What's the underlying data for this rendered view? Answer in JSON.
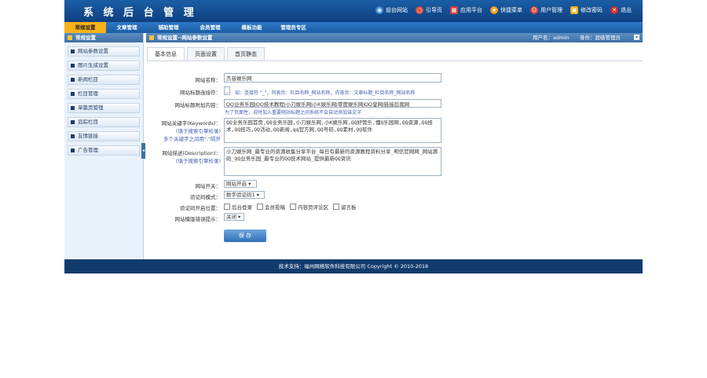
{
  "app": {
    "title": "系 统 后 台 管 理"
  },
  "top_links": [
    {
      "label": "前台网站",
      "icon": "globe-icon",
      "color": "#3b8de0"
    },
    {
      "label": "引导页",
      "icon": "lifebuoy-icon",
      "color": "#e04b3b"
    },
    {
      "label": "应用平台",
      "icon": "grid-icon",
      "color": "#d04040"
    },
    {
      "label": "快捷菜单",
      "icon": "star-icon",
      "color": "#f0a020"
    },
    {
      "label": "用户管理",
      "icon": "user-icon",
      "color": "#e04040"
    },
    {
      "label": "修改密码",
      "icon": "lock-icon",
      "color": "#f0b020"
    },
    {
      "label": "退出",
      "icon": "close-icon",
      "color": "#d03030"
    }
  ],
  "main_menu": [
    "常规设置",
    "文章管理",
    "辅助管理",
    "会员管理",
    "模板功能",
    "管理员专区"
  ],
  "sidebar": {
    "title": "常规设置",
    "items": [
      "网站参数设置",
      "图片生成设置",
      "新闻栏目",
      "栏目管理",
      "单篇页管理",
      "追踪栏目",
      "友情链接",
      "广告管理"
    ]
  },
  "pathbar": {
    "path": "常规设置--网站参数设置",
    "user": "用户名：admin",
    "auth": "身份：超级管理员"
  },
  "tabs": [
    "基本信息",
    "页面设置",
    "首页静态"
  ],
  "form": {
    "site_name": {
      "label": "网站名称：",
      "value": "杰音娱乐网"
    },
    "title_sep": {
      "label": "网站标题连接符：",
      "value": "_",
      "note": "如：连接符 \"_\"，列表页：栏目名称_网站名称，内容页：文章标题_栏目名称_网站名称"
    },
    "title_append": {
      "label": "网站标题附加内容：",
      "value": "QQ业务乐园|QQ技术教程|小刀娱乐网|小K娱乐网|零度娱乐网|QQ皇网|链接后我网",
      "note": "为了页面性，说时加入重要网站标题之间系统不会自动添加该文字"
    },
    "keywords": {
      "label": "网站关键字(Keywords)：",
      "hint": "(填于搜索引擎检录)",
      "hint2": "多个关键字之间用\",\"隔开",
      "value": "QQ业务乐园首页,QQ业务乐园,小刀娱乐网,小K娱乐网,QQ好赞乐,懂Q乐园网,QQ资源,QQ技术,QQ技巧,QQ活动,QQ新闻,qq官方网,QQ号码,QQ素材,QQ软件"
    },
    "description": {
      "label": "网站描述(Description)：",
      "hint": "(填于搜索引擎检录)",
      "value": "小刀娱乐网_最专业的资源收集分享平台_每日有最新的资源教程资料分享_明信官网网_网站源码_QQ业务乐园_最专业的QQ技术网站_提供最新QQ资讯"
    },
    "site_switch": {
      "label": "网站开关：",
      "value": "网站开启"
    },
    "captcha_mode": {
      "label": "验证码模式：",
      "value": "数字验证码1"
    },
    "captcha_locations": {
      "label": "验证码开启位置：",
      "options": [
        "后台登录",
        "会员投稿",
        "内容页评论区",
        "留言板"
      ]
    },
    "tpl_error": {
      "label": "网站模版错误提示：",
      "value": "关闭"
    }
  },
  "save_label": "保 存",
  "footer": "技术支持：福州网络软件科技有限公司   Copyright © 2010-2018"
}
